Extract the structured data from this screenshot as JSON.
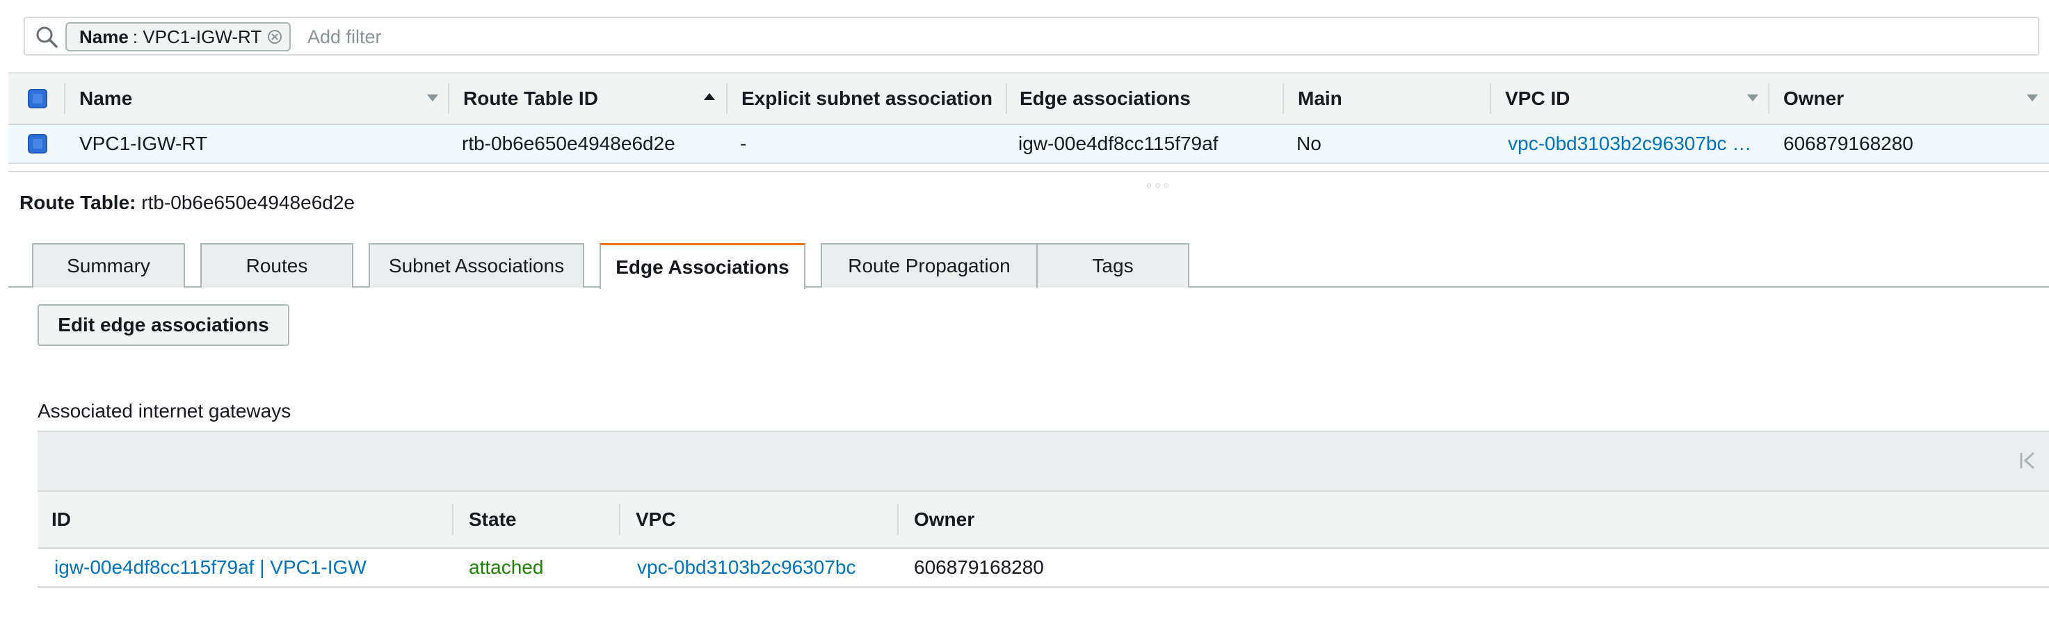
{
  "filter": {
    "chip_key": "Name",
    "chip_value": "VPC1-IGW-RT",
    "placeholder": "Add filter"
  },
  "table": {
    "columns": [
      "Name",
      "Route Table ID",
      "Explicit subnet association",
      "Edge associations",
      "Main",
      "VPC ID",
      "Owner"
    ],
    "rows": [
      {
        "name": "VPC1-IGW-RT",
        "route_table_id": "rtb-0b6e650e4948e6d2e",
        "explicit_subnet": "-",
        "edge_associations": "igw-00e4df8cc115f79af",
        "main": "No",
        "vpc_id": "vpc-0bd3103b2c96307bc …",
        "owner": "606879168280"
      }
    ]
  },
  "detail": {
    "label": "Route Table:",
    "value": "rtb-0b6e650e4948e6d2e"
  },
  "tabs": [
    "Summary",
    "Routes",
    "Subnet Associations",
    "Edge Associations",
    "Route Propagation",
    "Tags"
  ],
  "active_tab": "Edge Associations",
  "edit_button": "Edit edge associations",
  "associated": {
    "title": "Associated internet gateways",
    "columns": [
      "ID",
      "State",
      "VPC",
      "Owner"
    ],
    "rows": [
      {
        "id": "igw-00e4df8cc115f79af | VPC1-IGW",
        "state": "attached",
        "vpc": "vpc-0bd3103b2c96307bc",
        "owner": "606879168280"
      }
    ]
  },
  "colors": {
    "link": "#0073bb",
    "active_tab_accent": "#ec7211",
    "state_green": "#1d8102",
    "selected_row": "#f1f8fe"
  }
}
